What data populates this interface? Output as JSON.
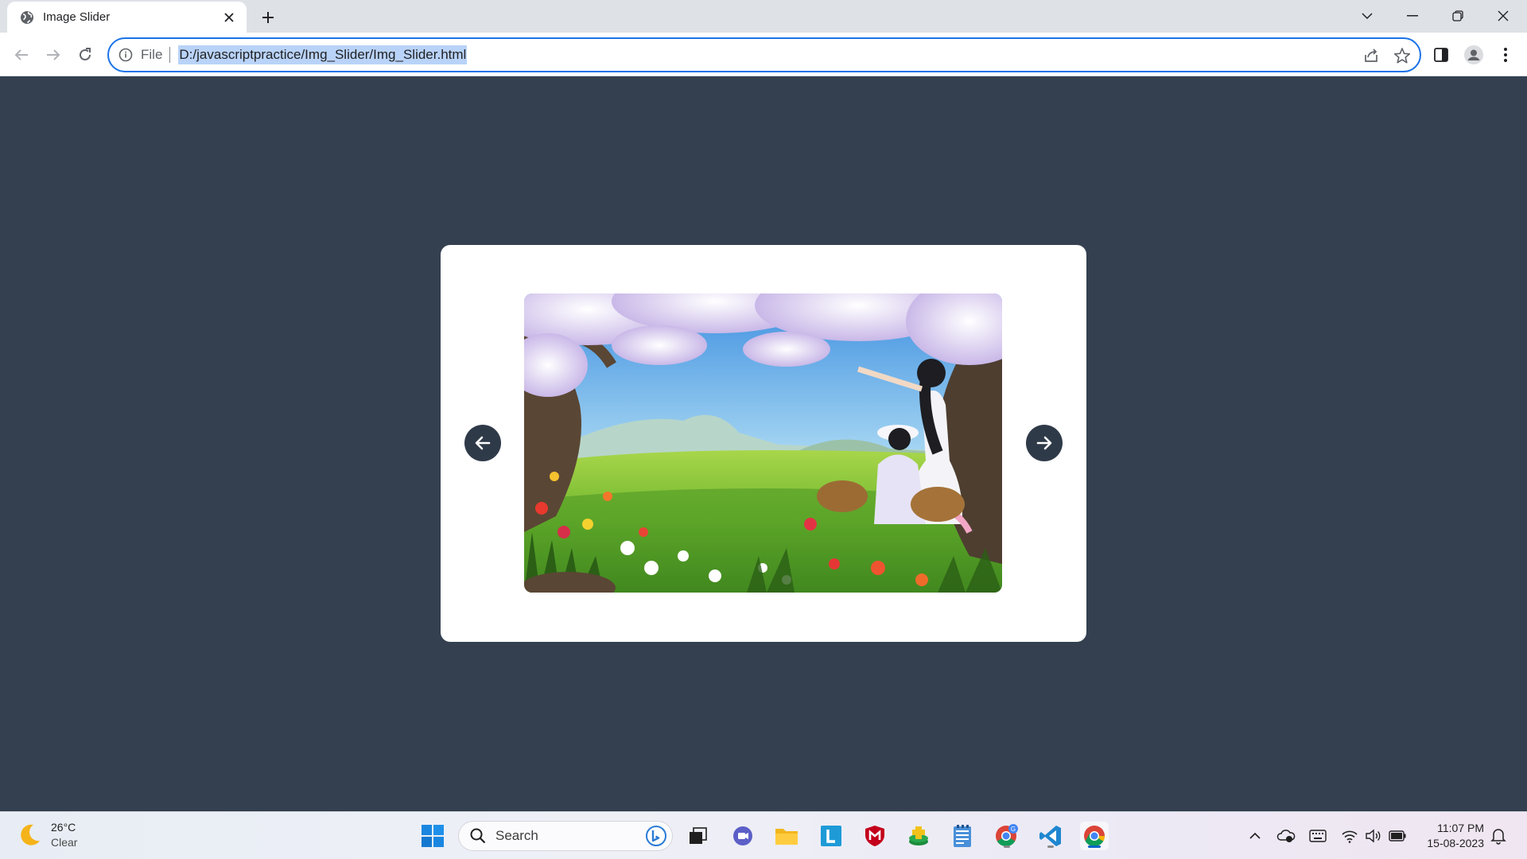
{
  "browser": {
    "tab_title": "Image Slider",
    "address_scheme": "File",
    "url": "D:/javascriptpractice/Img_Slider/Img_Slider.html"
  },
  "slider": {
    "image_description_icon": "spring-meadow-two-girls-image",
    "prev_icon": "arrow-left-icon",
    "next_icon": "arrow-right-icon"
  },
  "colors": {
    "page_background": "#344050",
    "card_background": "#ffffff",
    "arrow_button": "#2f3a49",
    "omnibox_focus": "#1a73e8",
    "url_selection": "#b9d3f8"
  },
  "taskbar": {
    "weather": {
      "temperature": "26°C",
      "condition": "Clear"
    },
    "search_label": "Search",
    "clock": {
      "time": "11:07 PM",
      "date": "15-08-2023"
    },
    "chrome_badge": "G"
  }
}
